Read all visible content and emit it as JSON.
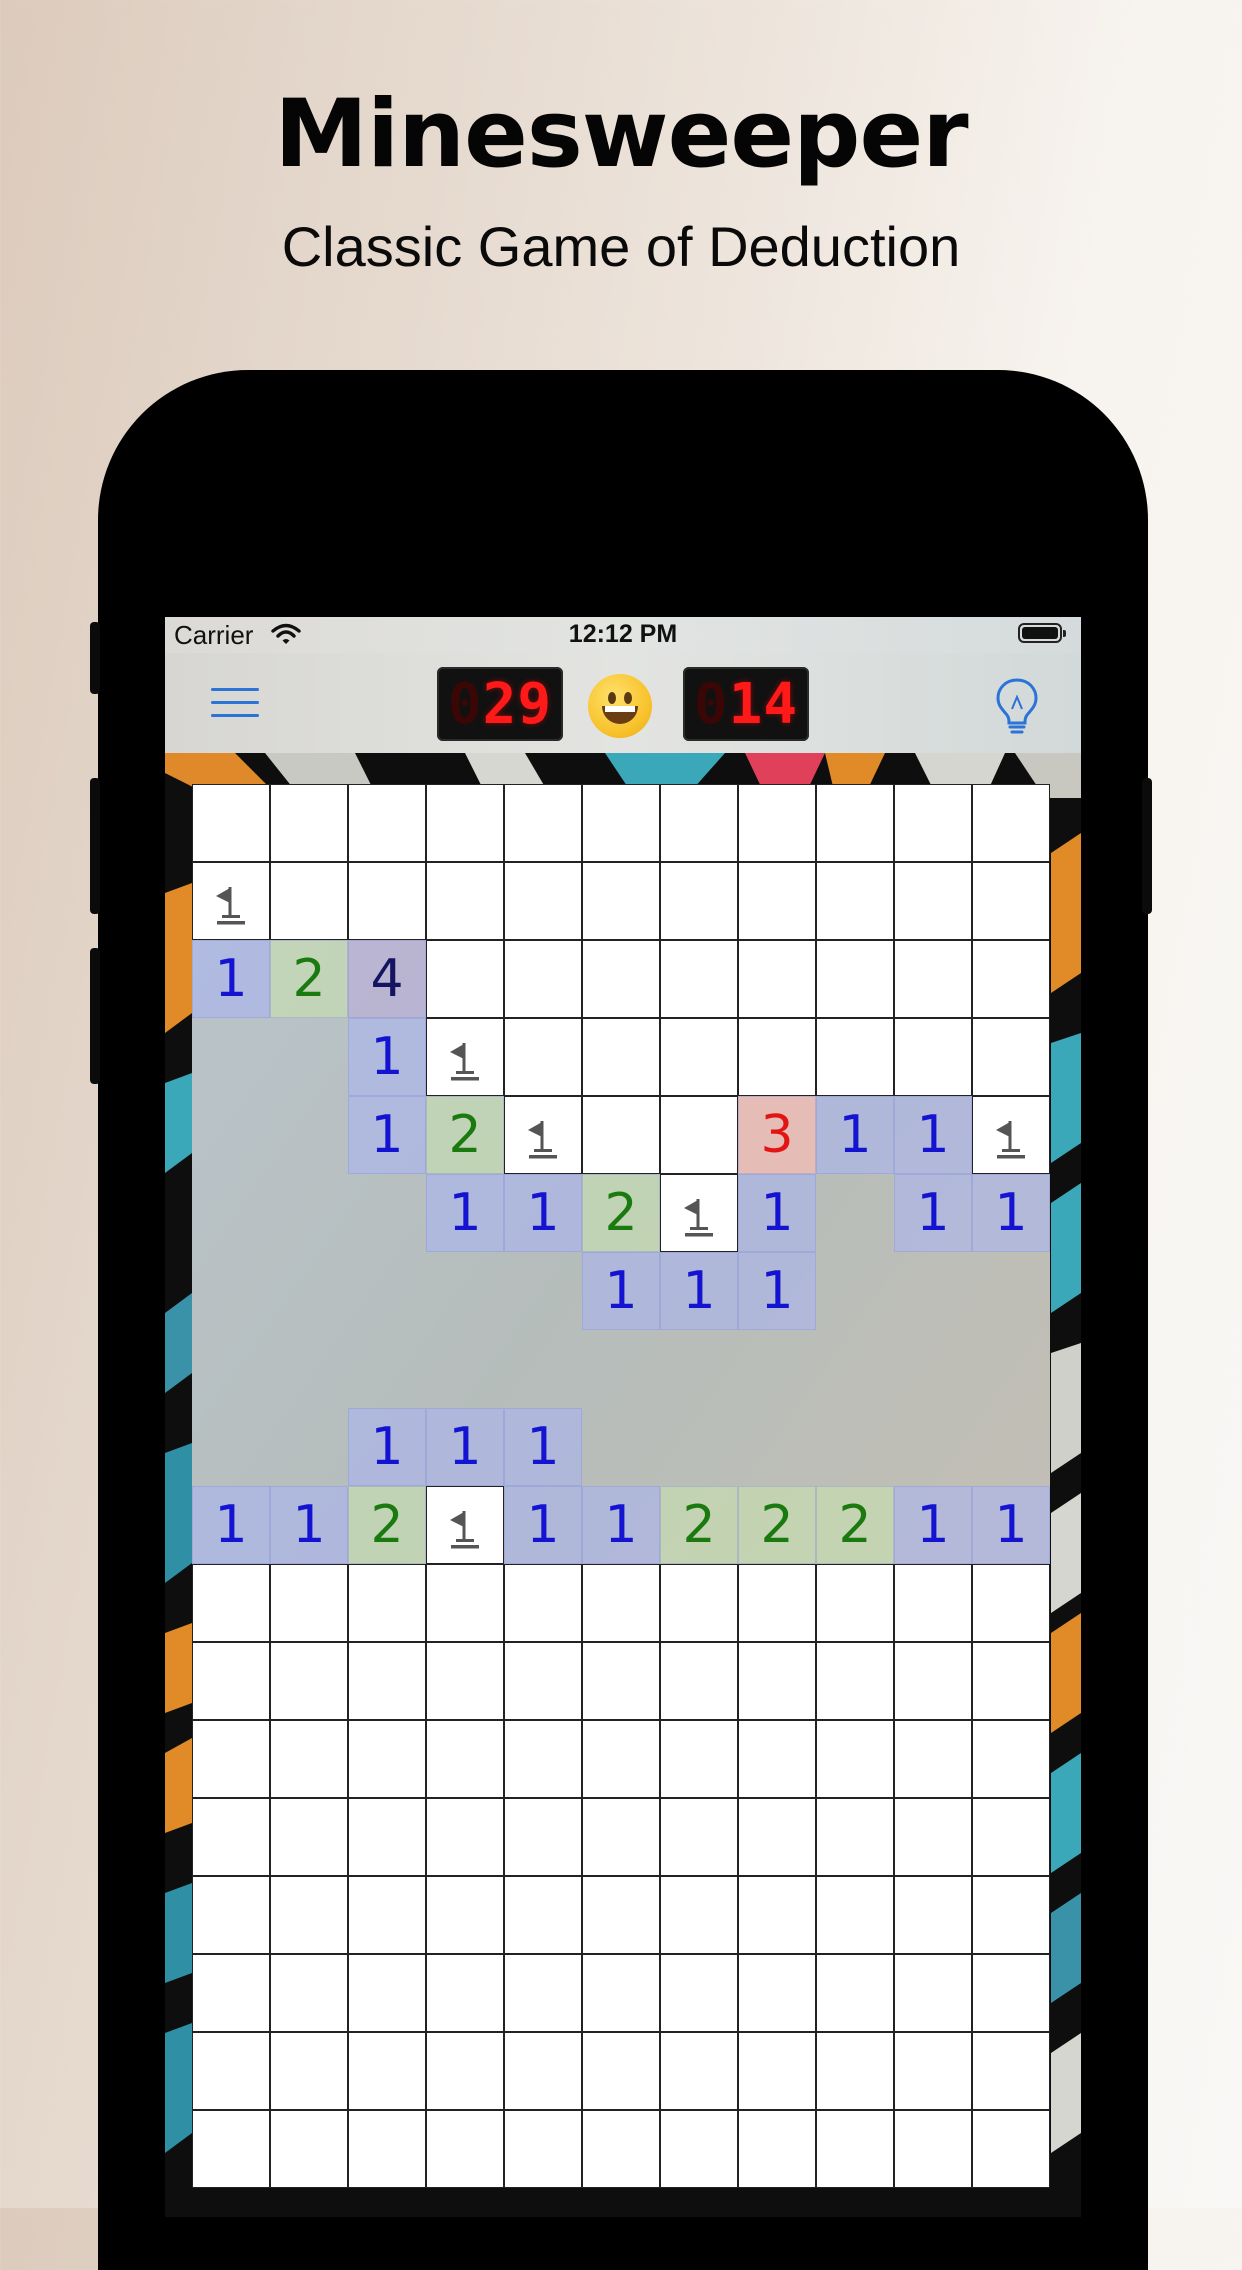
{
  "header": {
    "title": "Minesweeper",
    "subtitle": "Classic Game of Deduction"
  },
  "status_bar": {
    "carrier": "Carrier",
    "time": "12:12 PM"
  },
  "toolbar": {
    "mine_counter": "029",
    "timer": "014",
    "accent_color": "#2b73d6",
    "led_color": "#ff1a1a"
  },
  "board": {
    "columns": 11,
    "legend": {
      "C": "covered",
      "F": "flagged",
      "E": "revealed-empty",
      "1-8": "revealed-number"
    },
    "rows": [
      [
        "C",
        "C",
        "C",
        "C",
        "C",
        "C",
        "C",
        "C",
        "C",
        "C",
        "C"
      ],
      [
        "F",
        "C",
        "C",
        "C",
        "C",
        "C",
        "C",
        "C",
        "C",
        "C",
        "C"
      ],
      [
        "1",
        "2",
        "4",
        "C",
        "C",
        "C",
        "C",
        "C",
        "C",
        "C",
        "C"
      ],
      [
        "E",
        "E",
        "1",
        "F",
        "C",
        "C",
        "C",
        "C",
        "C",
        "C",
        "C"
      ],
      [
        "E",
        "E",
        "1",
        "2",
        "F",
        "C",
        "C",
        "3",
        "1",
        "1",
        "F"
      ],
      [
        "E",
        "E",
        "E",
        "1",
        "1",
        "2",
        "F",
        "1",
        "E",
        "1",
        "1"
      ],
      [
        "E",
        "E",
        "E",
        "E",
        "E",
        "1",
        "1",
        "1",
        "E",
        "E",
        "E"
      ],
      [
        "E",
        "E",
        "E",
        "E",
        "E",
        "E",
        "E",
        "E",
        "E",
        "E",
        "E"
      ],
      [
        "E",
        "E",
        "1",
        "1",
        "1",
        "E",
        "E",
        "E",
        "E",
        "E",
        "E"
      ],
      [
        "1",
        "1",
        "2",
        "F",
        "1",
        "1",
        "2",
        "2",
        "2",
        "1",
        "1"
      ],
      [
        "C",
        "C",
        "C",
        "C",
        "C",
        "C",
        "C",
        "C",
        "C",
        "C",
        "C"
      ],
      [
        "C",
        "C",
        "C",
        "C",
        "C",
        "C",
        "C",
        "C",
        "C",
        "C",
        "C"
      ],
      [
        "C",
        "C",
        "C",
        "C",
        "C",
        "C",
        "C",
        "C",
        "C",
        "C",
        "C"
      ],
      [
        "C",
        "C",
        "C",
        "C",
        "C",
        "C",
        "C",
        "C",
        "C",
        "C",
        "C"
      ],
      [
        "C",
        "C",
        "C",
        "C",
        "C",
        "C",
        "C",
        "C",
        "C",
        "C",
        "C"
      ],
      [
        "C",
        "C",
        "C",
        "C",
        "C",
        "C",
        "C",
        "C",
        "C",
        "C",
        "C"
      ],
      [
        "C",
        "C",
        "C",
        "C",
        "C",
        "C",
        "C",
        "C",
        "C",
        "C",
        "C"
      ],
      [
        "C",
        "C",
        "C",
        "C",
        "C",
        "C",
        "C",
        "C",
        "C",
        "C",
        "C"
      ]
    ]
  }
}
